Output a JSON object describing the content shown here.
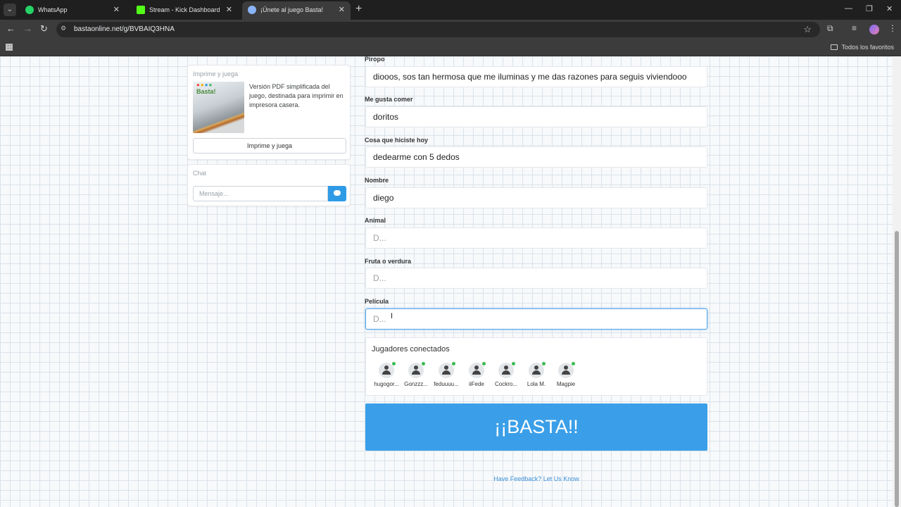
{
  "browser": {
    "tabs": [
      {
        "title": "WhatsApp",
        "active": false,
        "icon": "whatsapp-icon",
        "color": "#25d366"
      },
      {
        "title": "Stream - Kick Dashboard",
        "active": false,
        "icon": "kick-icon",
        "color": "#53fc18"
      },
      {
        "title": "¡Únete al juego Basta!",
        "active": true,
        "icon": "globe-icon",
        "color": "#8ab4f8"
      }
    ],
    "url": "bastaonline.net/g/BVBAIQ3HNA",
    "bookmarks_label": "Todos los favoritos"
  },
  "sidebar": {
    "print_card": {
      "title": "Imprime y juega",
      "description": "Versión PDF simplificada del juego, destinada para imprimir en impresora casera.",
      "thumb_logo": "Basta!",
      "button_label": "Imprime y juega"
    },
    "chat_card": {
      "title": "Chat",
      "input_placeholder": "Mensaje..."
    }
  },
  "form": {
    "fields": [
      {
        "label": "Piropo",
        "value": "diooos, sos tan hermosa que me iluminas y me das razones para seguis viviendooo"
      },
      {
        "label": "Me gusta comer",
        "value": "doritos"
      },
      {
        "label": "Cosa que hiciste hoy",
        "value": "dedearme con 5 dedos"
      },
      {
        "label": "Nombre",
        "value": "diego"
      },
      {
        "label": "Animal",
        "placeholder": "D..."
      },
      {
        "label": "Fruta o verdura",
        "placeholder": "D..."
      },
      {
        "label": "Película",
        "placeholder": "D..."
      }
    ]
  },
  "players": {
    "title": "Jugadores conectados",
    "list": [
      "hugogor...",
      "Gonzzz...",
      "feduuuu...",
      "iiFede",
      "Cockro...",
      "Lola M.",
      "Magpie"
    ]
  },
  "basta_button": "¡¡BASTA!!",
  "feedback_link": "Have Feedback? Let Us Know",
  "colors": {
    "accent": "#3a9fe8",
    "online": "#3cba54",
    "link": "#3a8fd6"
  }
}
